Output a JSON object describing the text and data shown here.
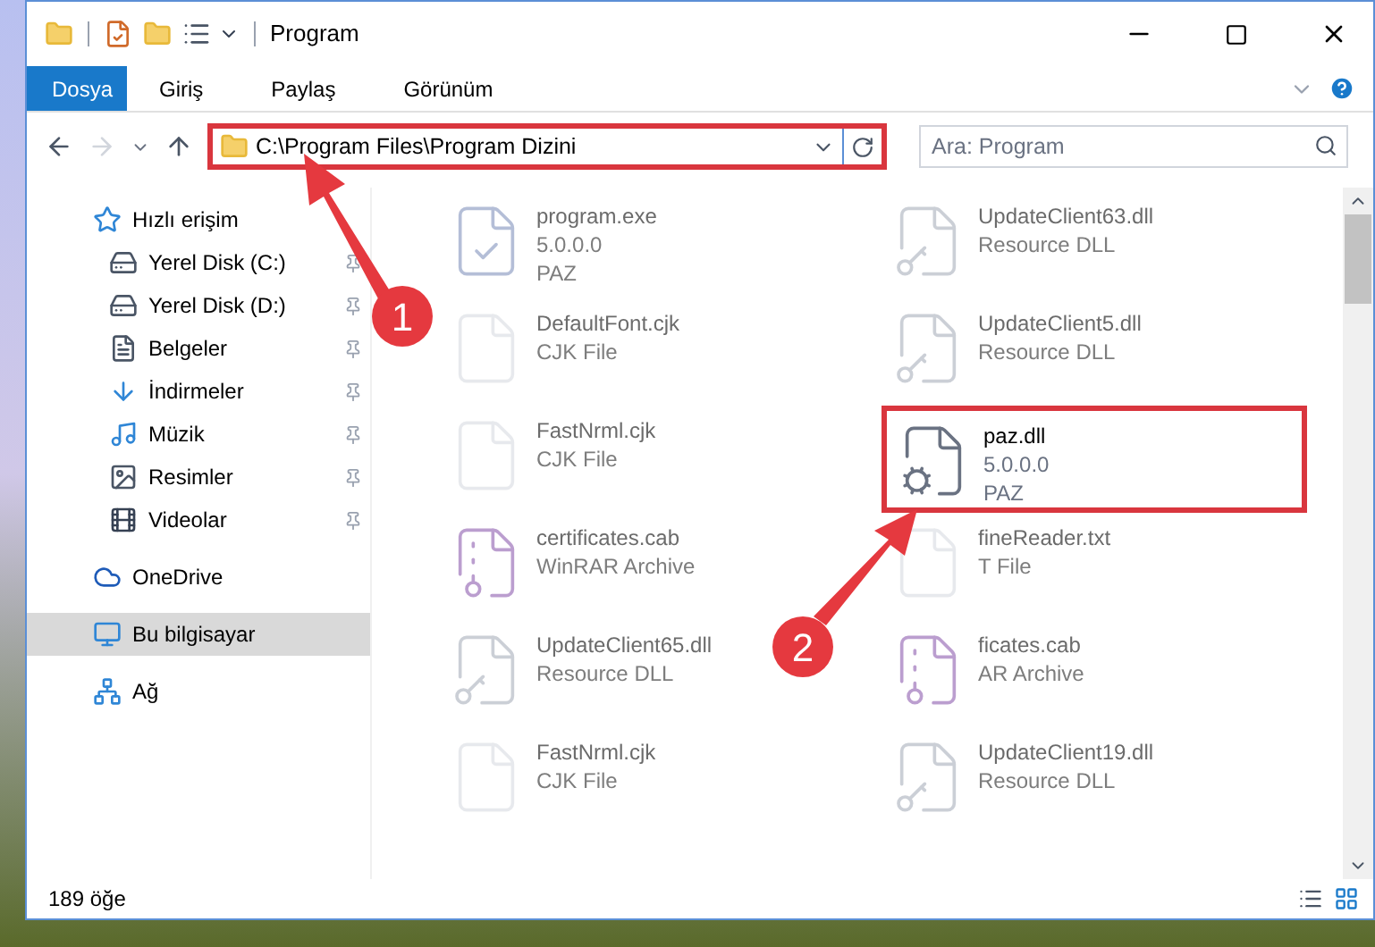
{
  "window": {
    "title": "Program"
  },
  "ribbon_tabs": [
    {
      "label": "Dosya",
      "selected": true
    },
    {
      "label": "Giriş",
      "selected": false
    },
    {
      "label": "Paylaş",
      "selected": false
    },
    {
      "label": "Görünüm",
      "selected": false
    }
  ],
  "address_bar": {
    "path": "C:\\Program Files\\Program Dizini",
    "highlighted": true
  },
  "search": {
    "placeholder": "Ara: Program"
  },
  "sidebar": {
    "items": [
      {
        "label": "Hızlı erişim",
        "selected": false,
        "children": [
          {
            "label": "Yerel Disk (C:)",
            "pinned": true,
            "selected": false
          },
          {
            "label": "Yerel Disk (D:)",
            "pinned": true,
            "selected": false
          },
          {
            "label": "Belgeler",
            "pinned": true,
            "selected": false
          },
          {
            "label": "İndirmeler",
            "pinned": true,
            "selected": false
          },
          {
            "label": "Müzik",
            "pinned": true,
            "selected": false
          },
          {
            "label": "Resimler",
            "pinned": true,
            "selected": false
          },
          {
            "label": "Videolar",
            "pinned": true,
            "selected": false
          }
        ]
      },
      {
        "label": "OneDrive",
        "selected": false
      },
      {
        "label": "Bu bilgisayar",
        "selected": true
      },
      {
        "label": "Ağ",
        "selected": false
      }
    ]
  },
  "files": [
    {
      "name": "program.exe",
      "details": [
        "5.0.0.0",
        "PAZ"
      ],
      "kind": "program",
      "highlighted": false,
      "dimmed": true
    },
    {
      "name": "UpdateClient63.dll",
      "details": [
        "Resource DLL"
      ],
      "kind": "library",
      "highlighted": false,
      "dimmed": true
    },
    {
      "name": "DefaultFont.cjk",
      "details": [
        "CJK File"
      ],
      "kind": "plain",
      "highlighted": false,
      "dimmed": true
    },
    {
      "name": "UpdateClient5.dll",
      "details": [
        "Resource DLL"
      ],
      "kind": "library",
      "highlighted": false,
      "dimmed": true
    },
    {
      "name": "FastNrml.cjk",
      "details": [
        "CJK File"
      ],
      "kind": "plain",
      "highlighted": false,
      "dimmed": true
    },
    {
      "name": "paz.dll",
      "details": [
        "5.0.0.0",
        "PAZ"
      ],
      "kind": "settings",
      "highlighted": true,
      "dimmed": false
    },
    {
      "name": "certificates.cab",
      "details": [
        "WinRAR Archive"
      ],
      "kind": "archive",
      "highlighted": false,
      "dimmed": true
    },
    {
      "name": "fineReader.txt",
      "details": [
        "T File"
      ],
      "kind": "plain",
      "highlighted": false,
      "dimmed": true
    },
    {
      "name": "UpdateClient65.dll",
      "details": [
        "Resource DLL"
      ],
      "kind": "library",
      "highlighted": false,
      "dimmed": true
    },
    {
      "name": "ficates.cab",
      "details": [
        "AR Archive"
      ],
      "kind": "archive",
      "highlighted": false,
      "dimmed": true
    },
    {
      "name": "FastNrml.cjk",
      "details": [
        "CJK File"
      ],
      "kind": "plain",
      "highlighted": false,
      "dimmed": true
    },
    {
      "name": "UpdateClient19.dll",
      "details": [
        "Resource DLL"
      ],
      "kind": "library",
      "highlighted": false,
      "dimmed": true
    }
  ],
  "status_bar": {
    "count": "189 öğe"
  },
  "annotations": [
    {
      "label": "1"
    },
    {
      "label": "2"
    }
  ]
}
